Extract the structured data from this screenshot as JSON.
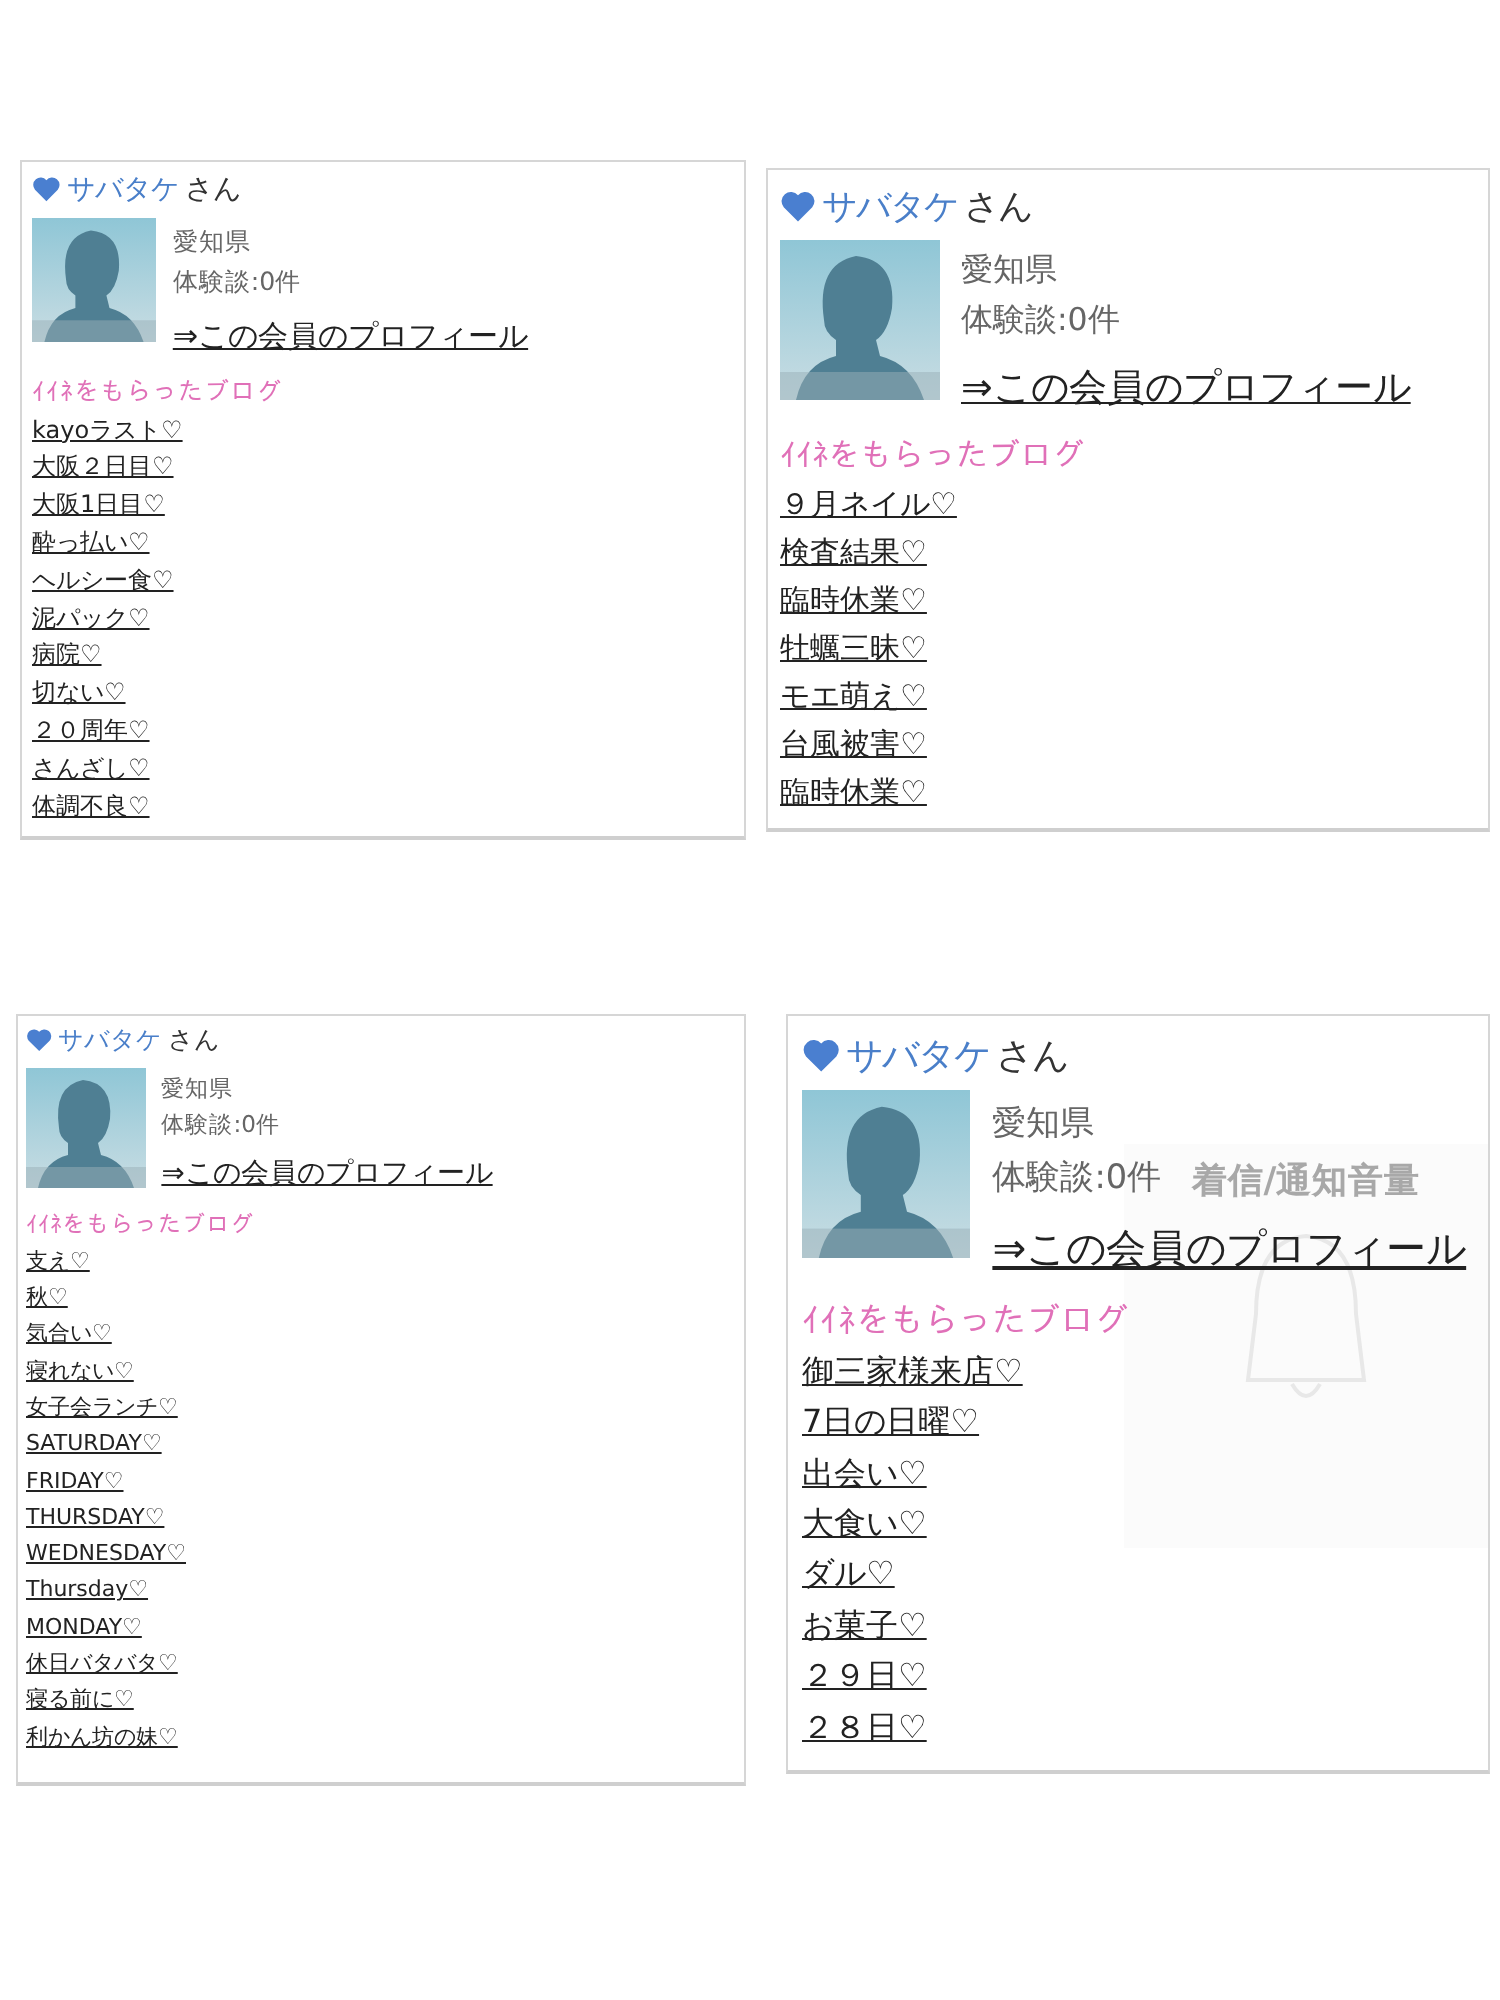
{
  "panels": [
    {
      "user_name": "サバタケ",
      "honorific": "さん",
      "prefecture": "愛知県",
      "reviews": "体験談:0件",
      "profile_link": "⇒この会員のプロフィール",
      "section_title": "ｲｲﾈをもらったブログ",
      "blogs": [
        "kayoラスト♡",
        "大阪２日目♡",
        "大阪1日目♡",
        "酔っ払い♡",
        "ヘルシー食♡",
        "泥パック♡",
        "病院♡",
        "切ない♡",
        "２０周年♡",
        "さんざし♡",
        "体調不良♡"
      ]
    },
    {
      "user_name": "サバタケ",
      "honorific": "さん",
      "prefecture": "愛知県",
      "reviews": "体験談:0件",
      "profile_link": "⇒この会員のプロフィール",
      "section_title": "ｲｲﾈをもらったブログ",
      "blogs": [
        "９月ネイル♡",
        "検査結果♡",
        "臨時休業♡",
        "牡蠣三昧♡",
        "モエ萌え♡",
        "台風被害♡",
        "臨時休業♡"
      ]
    },
    {
      "user_name": "サバタケ",
      "honorific": "さん",
      "prefecture": "愛知県",
      "reviews": "体験談:0件",
      "profile_link": "⇒この会員のプロフィール",
      "section_title": "ｲｲﾈをもらったブログ",
      "blogs": [
        "支え♡",
        "秋♡",
        "気合い♡",
        "寝れない♡",
        "女子会ランチ♡",
        "SATURDAY♡",
        "FRIDAY♡",
        "THURSDAY♡",
        "WEDNESDAY♡",
        "Thursday♡",
        "MONDAY♡",
        "休日バタバタ♡",
        "寝る前に♡",
        "利かん坊の妹♡"
      ]
    },
    {
      "user_name": "サバタケ",
      "honorific": "さん",
      "prefecture": "愛知県",
      "reviews": "体験談:0件",
      "profile_link": "⇒この会員のプロフィール",
      "section_title": "ｲｲﾈをもらったブログ",
      "blogs": [
        "御三家様来店♡",
        "7日の日曜♡",
        "出会い♡",
        "大食い♡",
        "ダル♡",
        "お菓子♡",
        "２９日♡",
        "２８日♡"
      ],
      "volume_hud": {
        "title": "着信/通知音量"
      }
    }
  ]
}
